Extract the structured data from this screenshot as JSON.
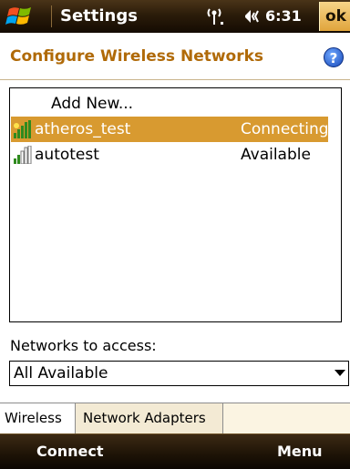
{
  "titlebar": {
    "title": "Settings",
    "clock": "6:31",
    "ok_label": "ok",
    "start_icon": "windows-flag-icon",
    "signal_icon": "signal-antenna-icon",
    "speaker_icon": "speaker-icon"
  },
  "header": {
    "title": "Configure Wireless Networks",
    "help_label": "?"
  },
  "network_list": {
    "add_new": "Add New...",
    "networks": [
      {
        "name": "atheros_test",
        "status": "Connecting",
        "selected": true
      },
      {
        "name": "autotest",
        "status": "Available",
        "selected": false
      }
    ]
  },
  "access": {
    "label": "Networks to access:",
    "selected": "All Available"
  },
  "tabs": [
    {
      "label": "Wireless",
      "active": true
    },
    {
      "label": "Network Adapters",
      "active": false
    }
  ],
  "softkeys": {
    "left": "Connect",
    "right": "Menu"
  },
  "colors": {
    "accent": "#d89a30",
    "header_text": "#b06a08",
    "titlebar": "#2b1c0a"
  }
}
